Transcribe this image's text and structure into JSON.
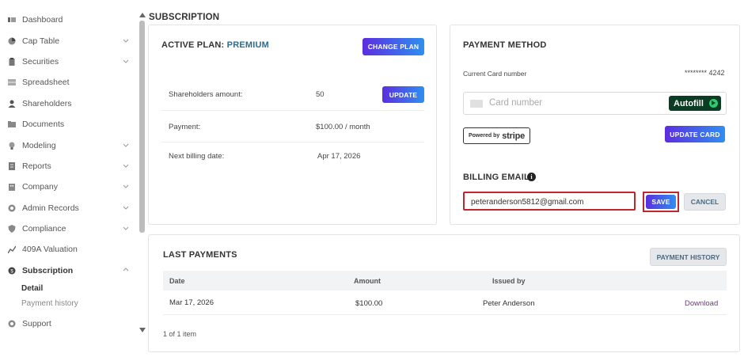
{
  "sidebar": {
    "items": [
      {
        "label": "Dashboard",
        "icon": "dashboard-icon"
      },
      {
        "label": "Cap Table",
        "icon": "pie-chart-icon"
      },
      {
        "label": "Securities",
        "icon": "clipboard-icon"
      },
      {
        "label": "Spreadsheet",
        "icon": "spreadsheet-icon"
      },
      {
        "label": "Shareholders",
        "icon": "person-icon"
      },
      {
        "label": "Documents",
        "icon": "folder-icon"
      },
      {
        "label": "Modeling",
        "icon": "lightbulb-icon"
      },
      {
        "label": "Reports",
        "icon": "report-icon"
      },
      {
        "label": "Company",
        "icon": "building-icon"
      },
      {
        "label": "Admin Records",
        "icon": "records-icon"
      },
      {
        "label": "Compliance",
        "icon": "shield-icon"
      },
      {
        "label": "409A Valuation",
        "icon": "valuation-icon"
      },
      {
        "label": "Subscription",
        "icon": "subscription-icon"
      },
      {
        "label": "Support",
        "icon": "support-icon"
      }
    ],
    "sub_items": [
      "Detail",
      "Payment history"
    ]
  },
  "page_title": "SUBSCRIPTION",
  "active_plan": {
    "label": "ACTIVE PLAN:",
    "plan": "PREMIUM",
    "change_plan": "CHANGE PLAN",
    "rows": [
      {
        "key": "Shareholders amount:",
        "value": "50"
      },
      {
        "key": "Payment:",
        "value": "$100.00 / month"
      },
      {
        "key": "Next billing date:",
        "value": "Apr 17, 2026"
      }
    ],
    "update": "UPDATE"
  },
  "payment_method": {
    "title": "PAYMENT METHOD",
    "current_card_label": "Current Card number",
    "current_card_value": "******** 4242",
    "card_placeholder": "Card number",
    "autofill": "Autofill",
    "powered_by": "Powered by",
    "stripe": "stripe",
    "update_card": "UPDATE CARD",
    "billing_email_title": "BILLING EMAIL",
    "info": "i",
    "email_value": "peteranderson5812@gmail.com",
    "save": "SAVE",
    "cancel": "CANCEL"
  },
  "last_payments": {
    "title": "LAST PAYMENTS",
    "history_button": "PAYMENT HISTORY",
    "columns": [
      "Date",
      "Amount",
      "Issued by"
    ],
    "rows": [
      {
        "date": "Mar 17, 2026",
        "amount": "$100.00",
        "issued_by": "Peter Anderson",
        "action": "Download"
      }
    ],
    "pager": "1 of 1 item"
  },
  "colors": {
    "accent_start": "#5b2ee0",
    "accent_end": "#2f8ff0",
    "highlight": "#c0262d",
    "plan": "#2e6b8f"
  }
}
